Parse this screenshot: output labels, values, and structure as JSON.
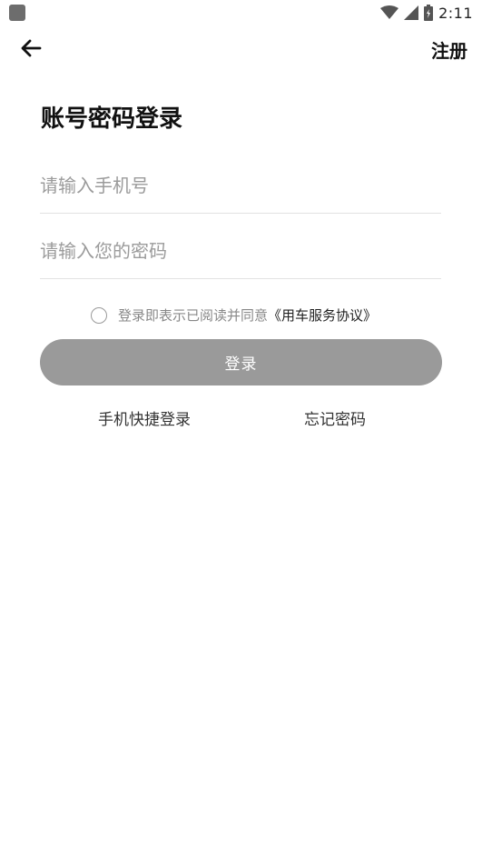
{
  "status_bar": {
    "time": "2:11",
    "icons": [
      "app-indicator-icon",
      "wifi-icon",
      "cellular-signal-icon",
      "battery-icon"
    ]
  },
  "header": {
    "back_icon": "back-arrow-icon",
    "register_label": "注册"
  },
  "title": "账号密码登录",
  "form": {
    "phone_placeholder": "请输入手机号",
    "phone_value": "",
    "password_placeholder": "请输入您的密码",
    "password_value": ""
  },
  "agreement": {
    "checked": false,
    "text": "登录即表示已阅读并同意",
    "link": "《用车服务协议》"
  },
  "login_button_label": "登录",
  "links": {
    "quick_login": "手机快捷登录",
    "forgot_password": "忘记密码"
  }
}
